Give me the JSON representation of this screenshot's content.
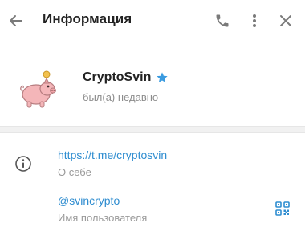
{
  "header": {
    "title": "Информация",
    "icons": {
      "back": "arrow-left-icon",
      "call": "phone-icon",
      "more": "more-vertical-icon",
      "close": "close-icon"
    }
  },
  "profile": {
    "name": "CryptoSvin",
    "status": "был(а) недавно",
    "avatar_icon": "pig-avatar-icon",
    "verified_icon": "star-icon"
  },
  "info": {
    "link": {
      "value": "https://t.me/cryptosvin",
      "label": "О себе"
    },
    "username": {
      "value": "@svincrypto",
      "label": "Имя пользователя"
    }
  },
  "colors": {
    "accent": "#2f8dd0",
    "verified": "#3a9be0",
    "muted": "#9a9a9a",
    "icon": "#7a7a7a"
  }
}
